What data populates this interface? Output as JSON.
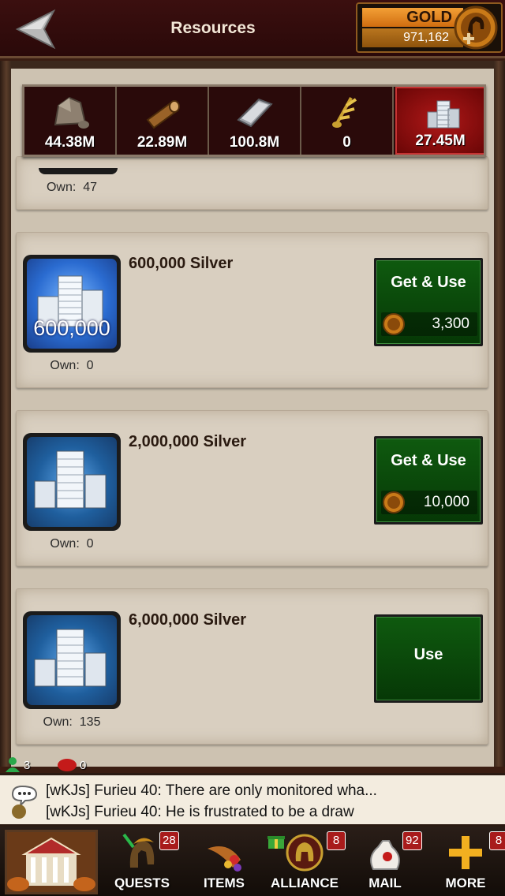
{
  "header": {
    "title": "Resources",
    "gold_label": "GOLD",
    "gold_value": "971,162"
  },
  "resources": [
    {
      "icon": "stone-icon",
      "value": "44.38M"
    },
    {
      "icon": "wood-icon",
      "value": "22.89M"
    },
    {
      "icon": "ore-icon",
      "value": "100.8M"
    },
    {
      "icon": "food-icon",
      "value": "0"
    },
    {
      "icon": "silver-icon",
      "value": "27.45M",
      "selected": true
    }
  ],
  "items": [
    {
      "own_label": "Own:",
      "own_count": "47"
    },
    {
      "name": "600,000 Silver",
      "icon_text": "600,000",
      "own_label": "Own:",
      "own_count": "0",
      "button_label": "Get & Use",
      "price": "3,300"
    },
    {
      "name": "2,000,000 Silver",
      "own_label": "Own:",
      "own_count": "0",
      "button_label": "Get & Use",
      "price": "10,000"
    },
    {
      "name": "6,000,000 Silver",
      "own_label": "Own:",
      "own_count": "135",
      "button_label": "Use"
    }
  ],
  "stats": {
    "players_online": "3",
    "alerts": "0"
  },
  "chat": [
    "[wKJs] Furieu 40: There are only monitored wha...",
    "[wKJs] Furieu 40: He is frustrated to be a draw"
  ],
  "nav": [
    {
      "label": "QUESTS",
      "badge": "28"
    },
    {
      "label": "ITEMS",
      "badge": ""
    },
    {
      "label": "ALLIANCE",
      "badge": "8"
    },
    {
      "label": "MAIL",
      "badge": "92"
    },
    {
      "label": "MORE",
      "badge": "8"
    }
  ],
  "colors": {
    "accent_green": "#0f5a0f",
    "selected_red": "#b01818",
    "gold": "#f3a036"
  }
}
